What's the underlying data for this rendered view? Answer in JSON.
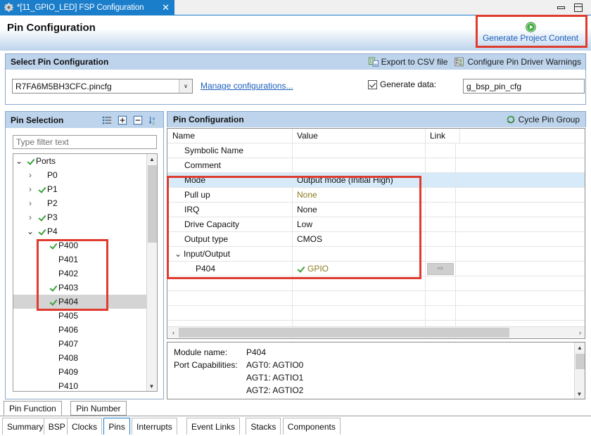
{
  "window": {
    "tab_title": "*[11_GPIO_LED] FSP Configuration",
    "close_glyph": "✕",
    "gear_icon": "gear-icon",
    "minimize_label": "Minimize",
    "maximize_label": "Maximize"
  },
  "header": {
    "title": "Pin Configuration",
    "generate_label": "Generate Project Content",
    "generate_icon": "green-play-icon"
  },
  "select_group": {
    "title": "Select Pin Configuration",
    "export_label": "Export to CSV file",
    "export_icon": "export-csv-icon",
    "warnings_label": "Configure Pin Driver Warnings",
    "warnings_icon": "pin-driver-warnings-icon",
    "combo_value": "R7FA6M5BH3CFC.pincfg",
    "combo_arrow": "∨",
    "manage_link": "Manage configurations...",
    "generate_data_label": "Generate data:",
    "generate_data_checked": true,
    "generate_data_value": "g_bsp_pin_cfg"
  },
  "pin_selection": {
    "title": "Pin Selection",
    "icons": [
      "list-view-icon",
      "expand-all-icon",
      "collapse-all-icon",
      "sort-az-icon"
    ],
    "filter_placeholder": "Type filter text",
    "tree": [
      {
        "label": "Ports",
        "indent": 0,
        "arrow": "down",
        "checked": true,
        "selected": false
      },
      {
        "label": "P0",
        "indent": 1,
        "arrow": "right",
        "checked": false,
        "selected": false
      },
      {
        "label": "P1",
        "indent": 1,
        "arrow": "right",
        "checked": true,
        "selected": false
      },
      {
        "label": "P2",
        "indent": 1,
        "arrow": "right",
        "checked": false,
        "selected": false
      },
      {
        "label": "P3",
        "indent": 1,
        "arrow": "right",
        "checked": true,
        "selected": false
      },
      {
        "label": "P4",
        "indent": 1,
        "arrow": "down",
        "checked": true,
        "selected": false
      },
      {
        "label": "P400",
        "indent": 2,
        "arrow": "none",
        "checked": true,
        "selected": false
      },
      {
        "label": "P401",
        "indent": 2,
        "arrow": "none",
        "checked": false,
        "selected": false
      },
      {
        "label": "P402",
        "indent": 2,
        "arrow": "none",
        "checked": false,
        "selected": false
      },
      {
        "label": "P403",
        "indent": 2,
        "arrow": "none",
        "checked": true,
        "selected": false
      },
      {
        "label": "P404",
        "indent": 2,
        "arrow": "none",
        "checked": true,
        "selected": true
      },
      {
        "label": "P405",
        "indent": 2,
        "arrow": "none",
        "checked": false,
        "selected": false
      },
      {
        "label": "P406",
        "indent": 2,
        "arrow": "none",
        "checked": false,
        "selected": false
      },
      {
        "label": "P407",
        "indent": 2,
        "arrow": "none",
        "checked": false,
        "selected": false
      },
      {
        "label": "P408",
        "indent": 2,
        "arrow": "none",
        "checked": false,
        "selected": false
      },
      {
        "label": "P409",
        "indent": 2,
        "arrow": "none",
        "checked": false,
        "selected": false
      },
      {
        "label": "P410",
        "indent": 2,
        "arrow": "none",
        "checked": false,
        "selected": false
      }
    ]
  },
  "pin_configuration": {
    "title": "Pin Configuration",
    "cycle_label": "Cycle Pin Group",
    "cycle_icon": "cycle-refresh-icon",
    "columns": [
      "Name",
      "Value",
      "Link",
      ""
    ],
    "rows": [
      {
        "name": "Name",
        "indent": 0,
        "expander": "none",
        "value": "",
        "value_style": "header",
        "link": "none",
        "highlight": false,
        "header": true
      },
      {
        "name": "Symbolic Name",
        "indent": 1,
        "expander": "none",
        "value": "",
        "value_style": "dark",
        "link": "none",
        "highlight": false,
        "header": false
      },
      {
        "name": "Comment",
        "indent": 1,
        "expander": "none",
        "value": "",
        "value_style": "dark",
        "link": "none",
        "highlight": false,
        "header": false
      },
      {
        "name": "Mode",
        "indent": 1,
        "expander": "none",
        "value": "Output mode (Initial High)",
        "value_style": "dark",
        "link": "none",
        "highlight": true,
        "header": false
      },
      {
        "name": "Pull up",
        "indent": 1,
        "expander": "none",
        "value": "None",
        "value_style": "olive",
        "link": "none",
        "highlight": false,
        "header": false
      },
      {
        "name": "IRQ",
        "indent": 1,
        "expander": "none",
        "value": "None",
        "value_style": "dark",
        "link": "none",
        "highlight": false,
        "header": false
      },
      {
        "name": "Drive Capacity",
        "indent": 1,
        "expander": "none",
        "value": "Low",
        "value_style": "dark",
        "link": "none",
        "highlight": false,
        "header": false
      },
      {
        "name": "Output type",
        "indent": 1,
        "expander": "none",
        "value": "CMOS",
        "value_style": "dark",
        "link": "none",
        "highlight": false,
        "header": false
      },
      {
        "name": "Input/Output",
        "indent": 0,
        "expander": "down",
        "value": "",
        "value_style": "dark",
        "link": "none",
        "highlight": false,
        "header": false
      },
      {
        "name": "P404",
        "indent": 2,
        "expander": "none",
        "value": "GPIO",
        "value_style": "gpio",
        "link": "arrow",
        "highlight": false,
        "header": false
      },
      {
        "name": "",
        "indent": 0,
        "expander": "none",
        "value": "",
        "value_style": "dark",
        "link": "none",
        "highlight": false,
        "header": false
      }
    ],
    "hscroll_left_glyph": "‹",
    "hscroll_right_glyph": "›"
  },
  "details": {
    "module_name_label": "Module name:",
    "module_name_value": "P404",
    "port_capabilities_label": "Port Capabilities:",
    "port_capabilities_values": [
      "AGT0: AGTIO0",
      "AGT1: AGTIO1",
      "AGT2: AGTIO2"
    ]
  },
  "sub_tabs": [
    {
      "label": "Pin Function",
      "active": true
    },
    {
      "label": "Pin Number",
      "active": false
    }
  ],
  "main_tabs": [
    {
      "label": "Summary",
      "active": false
    },
    {
      "label": "BSP",
      "active": false
    },
    {
      "label": "Clocks",
      "active": false
    },
    {
      "label": "Pins",
      "active": true
    },
    {
      "label": "Interrupts",
      "active": false
    },
    {
      "label": "Event Links",
      "active": false
    },
    {
      "label": "Stacks",
      "active": false
    },
    {
      "label": "Components",
      "active": false
    }
  ],
  "colors": {
    "accent_blue": "#1b7ecb",
    "panel_header_blue": "#bdd4ec",
    "link_blue": "#1b5fbd",
    "check_green": "#3aa03a",
    "olive_value": "#8a7a1e",
    "annotation_red": "#e03b2f",
    "row_highlight": "#d6eaf9",
    "tree_selection": "#d4d4d4"
  },
  "annotations": [
    {
      "name": "generate-project-content-highlight"
    },
    {
      "name": "pin-tree-p400-p404-highlight"
    },
    {
      "name": "pin-config-properties-highlight"
    }
  ]
}
